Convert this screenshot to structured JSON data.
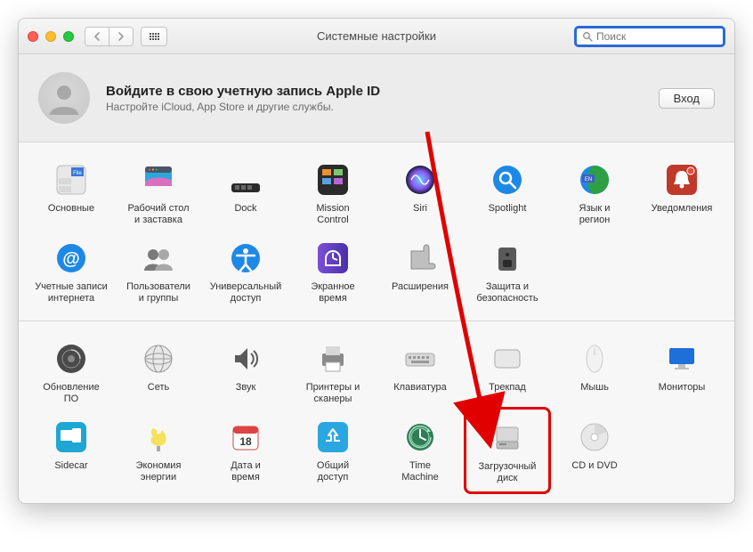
{
  "window": {
    "title": "Системные настройки",
    "search_placeholder": "Поиск"
  },
  "banner": {
    "heading": "Войдите в свою учетную запись Apple ID",
    "sub": "Настройте iCloud, App Store и другие службы.",
    "signin": "Вход"
  },
  "rows": [
    [
      {
        "name": "general",
        "label": "Основные"
      },
      {
        "name": "desktop",
        "label": "Рабочий стол\nи заставка"
      },
      {
        "name": "dock",
        "label": "Dock"
      },
      {
        "name": "mission",
        "label": "Mission\nControl"
      },
      {
        "name": "siri",
        "label": "Siri"
      },
      {
        "name": "spotlight",
        "label": "Spotlight"
      },
      {
        "name": "language",
        "label": "Язык и\nрегион"
      },
      {
        "name": "notifications",
        "label": "Уведомления"
      }
    ],
    [
      {
        "name": "internet",
        "label": "Учетные записи\nинтернета"
      },
      {
        "name": "users",
        "label": "Пользователи\nи группы"
      },
      {
        "name": "accessibility",
        "label": "Универсальный\nдоступ"
      },
      {
        "name": "screentime",
        "label": "Экранное\nвремя"
      },
      {
        "name": "extensions",
        "label": "Расширения"
      },
      {
        "name": "security",
        "label": "Защита и\nбезопасность"
      },
      {
        "name": "blank1",
        "label": ""
      },
      {
        "name": "blank2",
        "label": ""
      }
    ],
    [
      {
        "name": "update",
        "label": "Обновление\nПО"
      },
      {
        "name": "network",
        "label": "Сеть"
      },
      {
        "name": "sound",
        "label": "Звук"
      },
      {
        "name": "printers",
        "label": "Принтеры и\nсканеры"
      },
      {
        "name": "keyboard",
        "label": "Клавиатура"
      },
      {
        "name": "trackpad",
        "label": "Трекпад"
      },
      {
        "name": "mouse",
        "label": "Мышь"
      },
      {
        "name": "displays",
        "label": "Мониторы"
      }
    ],
    [
      {
        "name": "sidecar",
        "label": "Sidecar"
      },
      {
        "name": "energy",
        "label": "Экономия\nэнергии"
      },
      {
        "name": "datetime",
        "label": "Дата и\nвремя"
      },
      {
        "name": "sharing",
        "label": "Общий\nдоступ"
      },
      {
        "name": "timemachine",
        "label": "Time\nMachine"
      },
      {
        "name": "startup",
        "label": "Загрузочный\nдиск",
        "highlight": true
      },
      {
        "name": "cddvd",
        "label": "CD и DVD"
      },
      {
        "name": "blank3",
        "label": ""
      }
    ]
  ]
}
